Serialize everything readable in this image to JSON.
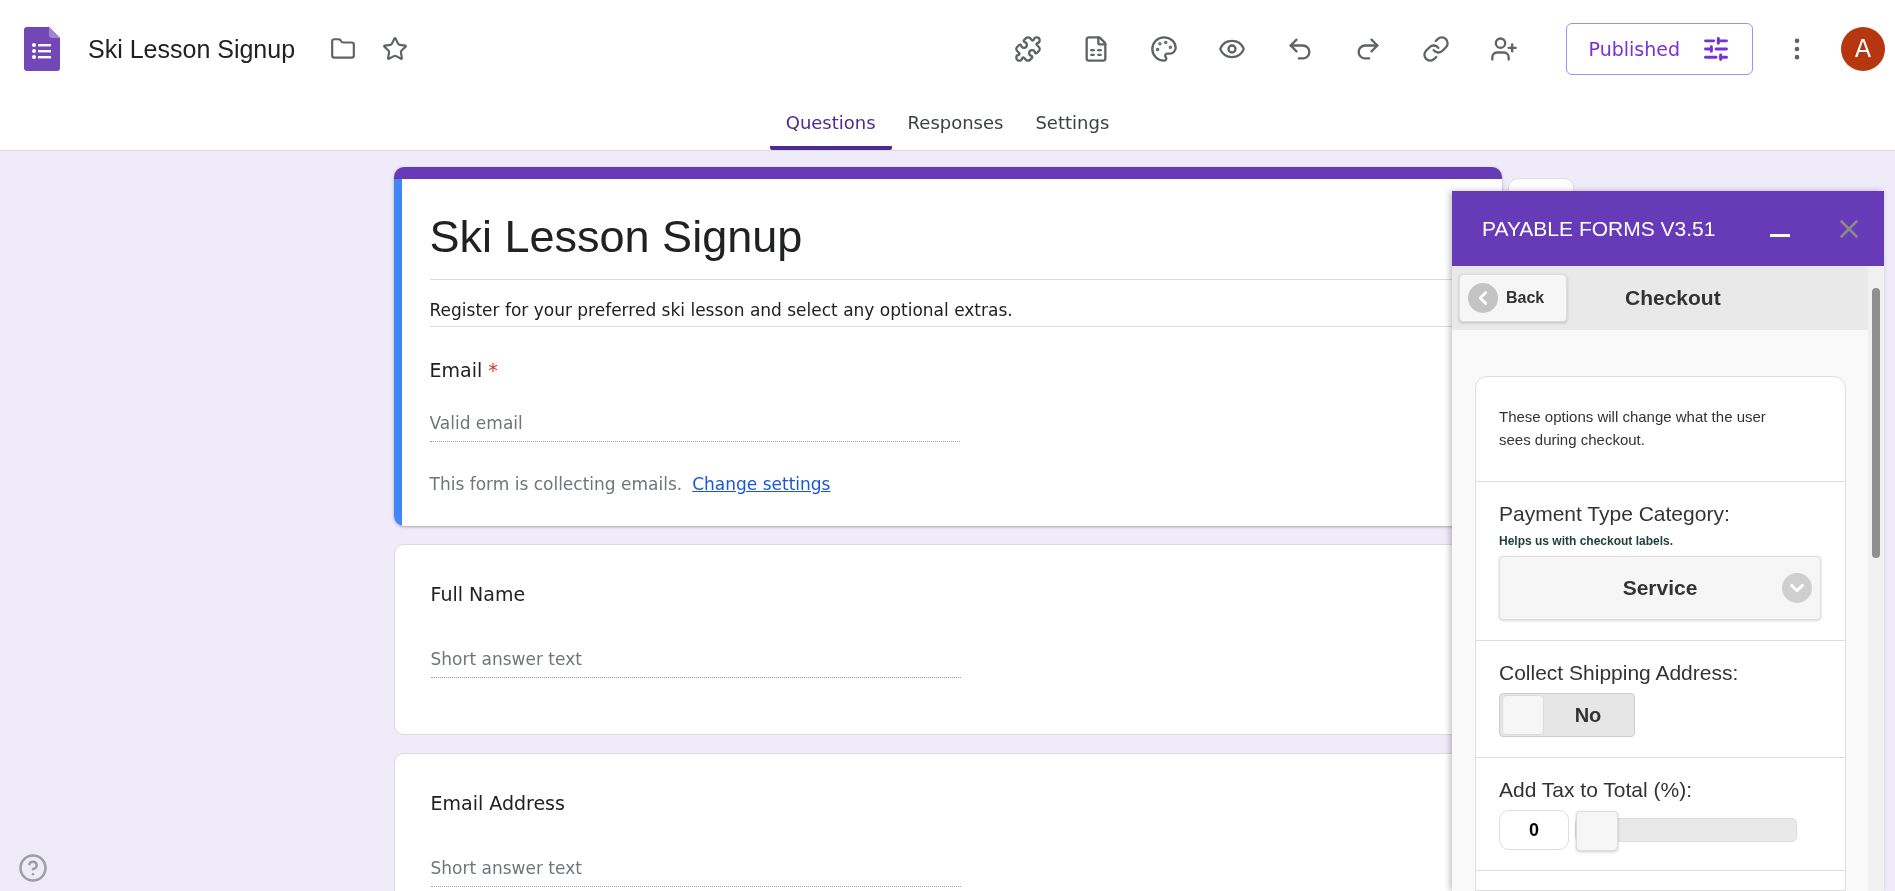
{
  "app": {
    "title": "Ski Lesson Signup",
    "publish_label": "Published",
    "avatar": "A"
  },
  "tabs": [
    {
      "label": "Questions",
      "selected": true
    },
    {
      "label": "Responses",
      "selected": false
    },
    {
      "label": "Settings",
      "selected": false
    }
  ],
  "form": {
    "title": "Ski Lesson Signup",
    "description": "Register for your preferred ski lesson and select any optional extras.",
    "email_question": {
      "label": "Email",
      "required": true,
      "required_mark": "*",
      "placeholder": "Valid email"
    },
    "email_note": "This form is collecting emails.",
    "email_link": "Change settings",
    "questions": [
      {
        "label": "Full Name",
        "placeholder": "Short answer text"
      },
      {
        "label": "Email Address",
        "placeholder": "Short answer text"
      }
    ]
  },
  "panel": {
    "title": "PAYABLE FORMS V3.51",
    "back": "Back",
    "heading": "Checkout",
    "intro": "These options will change what the user sees during checkout.",
    "fields": [
      {
        "kind": "select",
        "label": "Payment Type Category:",
        "hint": "Helps us with checkout labels.",
        "value": "Service"
      },
      {
        "kind": "toggle",
        "label": "Collect Shipping Address:",
        "on": false,
        "value": "No"
      },
      {
        "kind": "slider",
        "label": "Add Tax to Total (%):",
        "value": "0",
        "level": 0
      }
    ]
  }
}
